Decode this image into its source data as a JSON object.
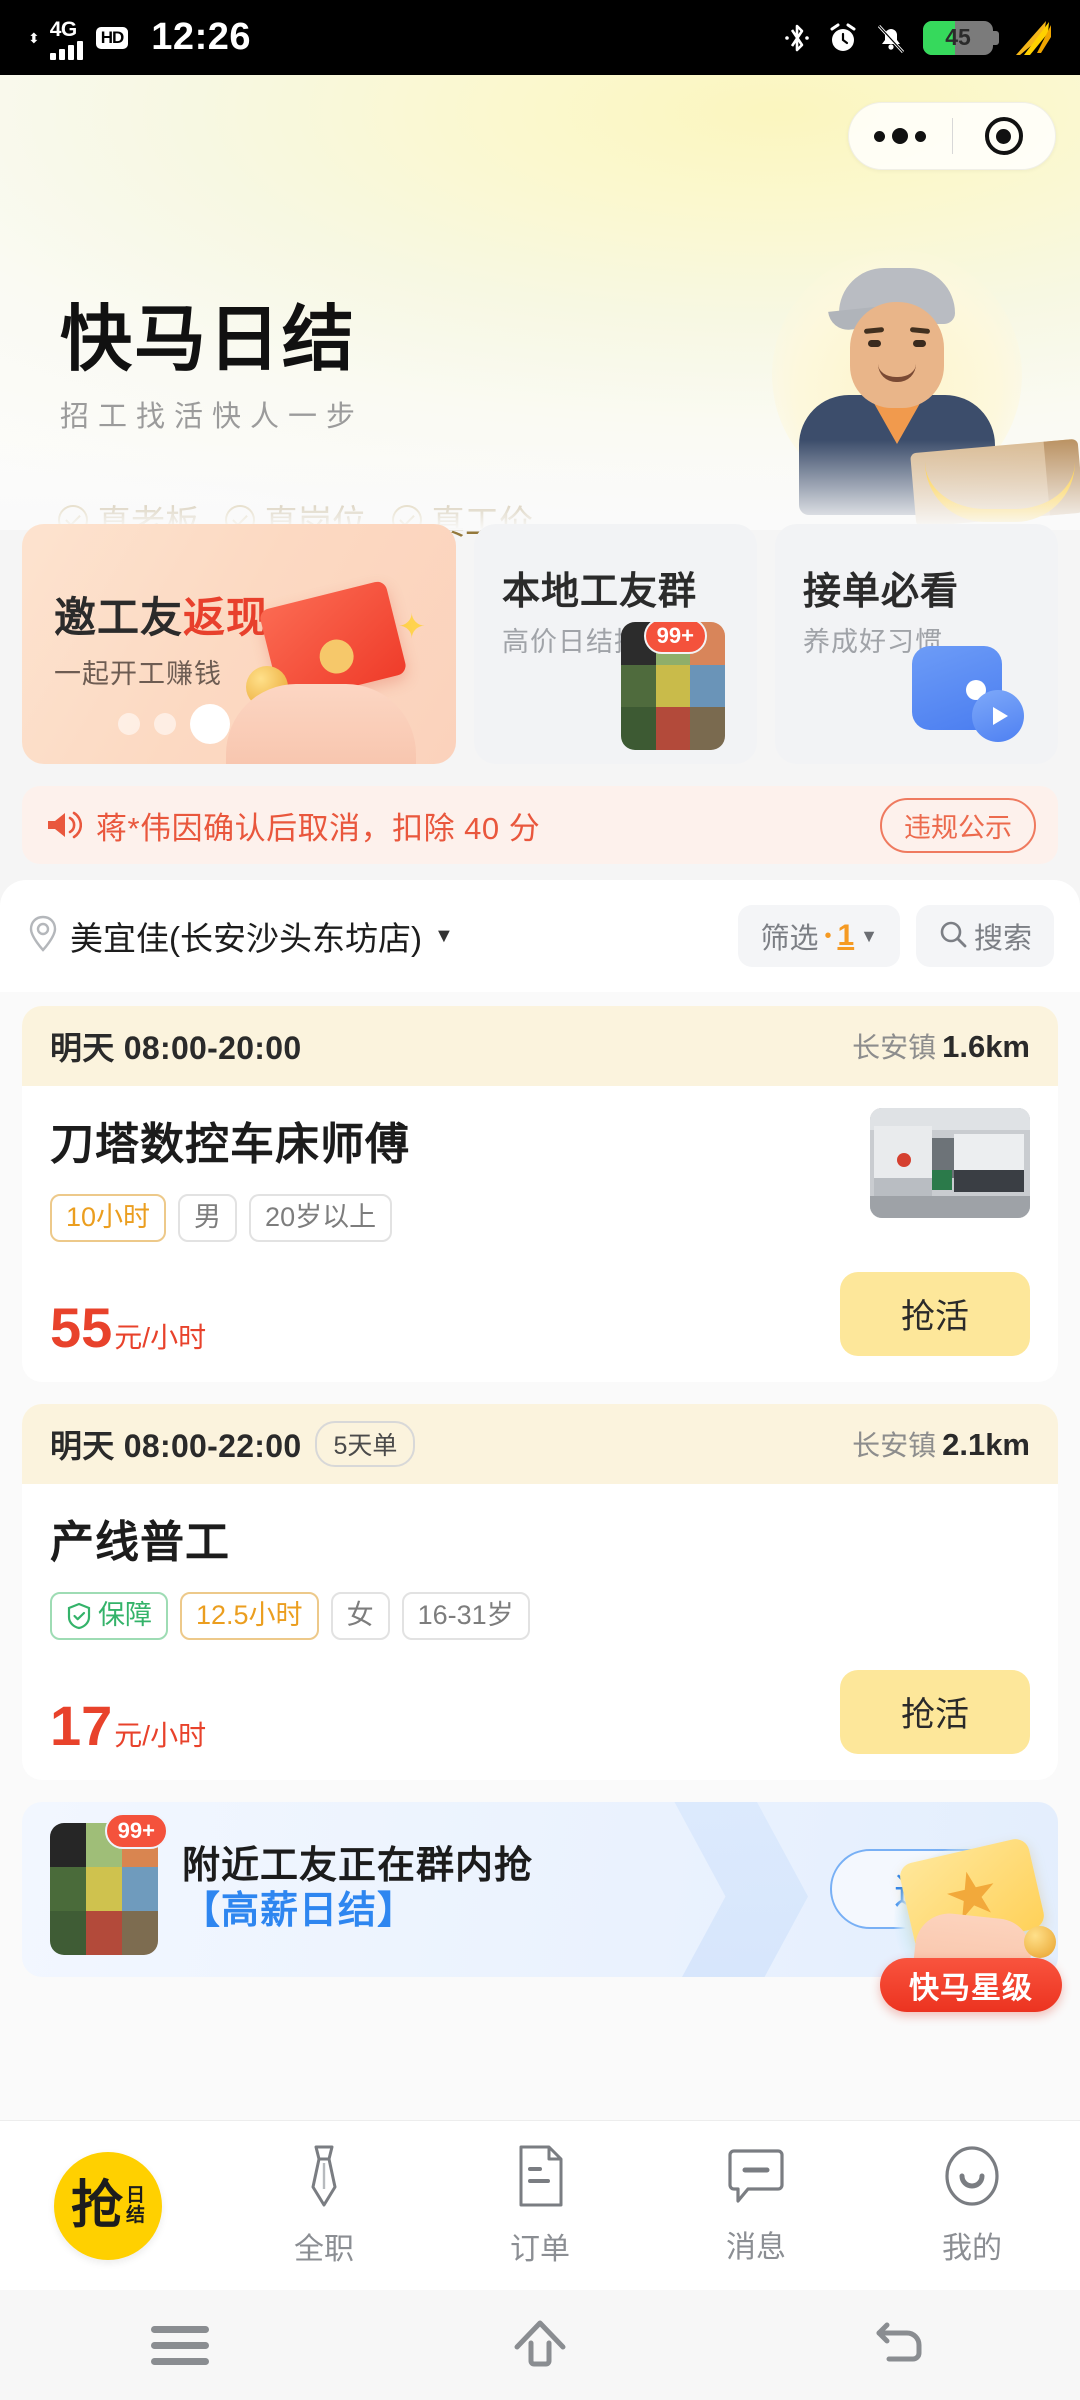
{
  "statusbar": {
    "network": "4G",
    "hd": "HD",
    "time": "12:26",
    "battery_level": "45",
    "icons": [
      "bluetooth-icon",
      "alarm-icon",
      "bell-muted-icon",
      "battery-icon",
      "flash-icon"
    ]
  },
  "capsule": {
    "more": "•••",
    "close": "target"
  },
  "header": {
    "title": "快马日结",
    "subtitle": "招工找活快人一步",
    "features": [
      "真老板",
      "真岗位",
      "真工价"
    ]
  },
  "promos": [
    {
      "title_a": "邀工友",
      "title_b": "返现",
      "subtitle": "一起开工赚钱"
    },
    {
      "title": "本地工友群",
      "subtitle": "高价日结推荐",
      "badge": "99+"
    },
    {
      "title": "接单必看",
      "subtitle": "养成好习惯"
    }
  ],
  "announcement": {
    "text": "蒋*伟因确认后取消，扣除 40 分",
    "action": "违规公示"
  },
  "filterbar": {
    "location": "美宜佳(长安沙头东坊店)",
    "filter_label": "筛选",
    "filter_dot": "•",
    "filter_count": "1",
    "search_label": "搜索"
  },
  "jobs": [
    {
      "time": "明天 08:00-20:00",
      "day_chip": "",
      "region": "长安镇",
      "distance": "1.6km",
      "title": "刀塔数控车床师傅",
      "tags": [
        {
          "text": "10小时",
          "style": "hours"
        },
        {
          "text": "男",
          "style": "plain"
        },
        {
          "text": "20岁以上",
          "style": "plain"
        }
      ],
      "price": "55",
      "price_unit": "元/小时",
      "action": "抢活"
    },
    {
      "time": "明天 08:00-22:00",
      "day_chip": "5天单",
      "region": "长安镇",
      "distance": "2.1km",
      "title": "产线普工",
      "tags": [
        {
          "text": "保障",
          "style": "guard"
        },
        {
          "text": "12.5小时",
          "style": "hours"
        },
        {
          "text": "女",
          "style": "plain"
        },
        {
          "text": "16-31岁",
          "style": "plain"
        }
      ],
      "price": "17",
      "price_unit": "元/小时",
      "action": "抢活"
    }
  ],
  "group_banner": {
    "badge": "99+",
    "line1": "附近工友正在群内抢",
    "line2": "【高薪日结】",
    "action": "进群"
  },
  "sticker": {
    "label": "快马星级"
  },
  "tabbar": {
    "logo_main": "抢",
    "logo_sub_top": "日",
    "logo_sub_bottom": "结",
    "items": [
      {
        "label": "全职",
        "icon": "tie-icon"
      },
      {
        "label": "订单",
        "icon": "document-icon"
      },
      {
        "label": "消息",
        "icon": "chat-icon"
      },
      {
        "label": "我的",
        "icon": "face-icon"
      }
    ]
  },
  "navbar": {
    "recents": "recents-icon",
    "home": "home-icon",
    "back": "back-icon"
  },
  "colors": {
    "accent_yellow": "#ffd000",
    "price_red": "#e8422b",
    "tag_orange": "#eb9e1f",
    "guard_green": "#34b36a",
    "link_blue": "#2e86f0",
    "announce_red": "#e9573d"
  }
}
